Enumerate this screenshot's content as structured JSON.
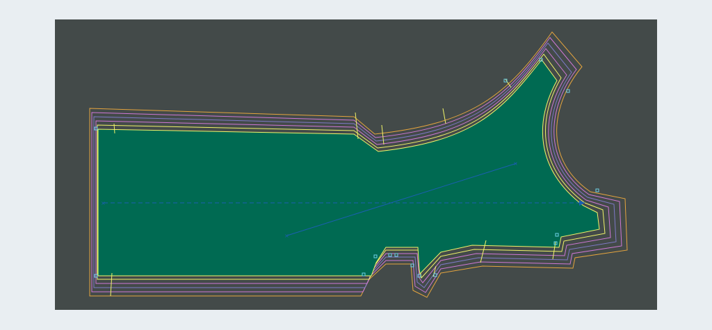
{
  "canvas": {
    "background_color": "#434a49",
    "page_color": "#e9eef2"
  },
  "piece": {
    "fill_color": "#006a52",
    "contour_colors": [
      "#f2f56a",
      "#cf78d6",
      "#7f79c8",
      "#cf78d6",
      "#e6a53e"
    ],
    "grainline_color": "#1b5fb2"
  }
}
